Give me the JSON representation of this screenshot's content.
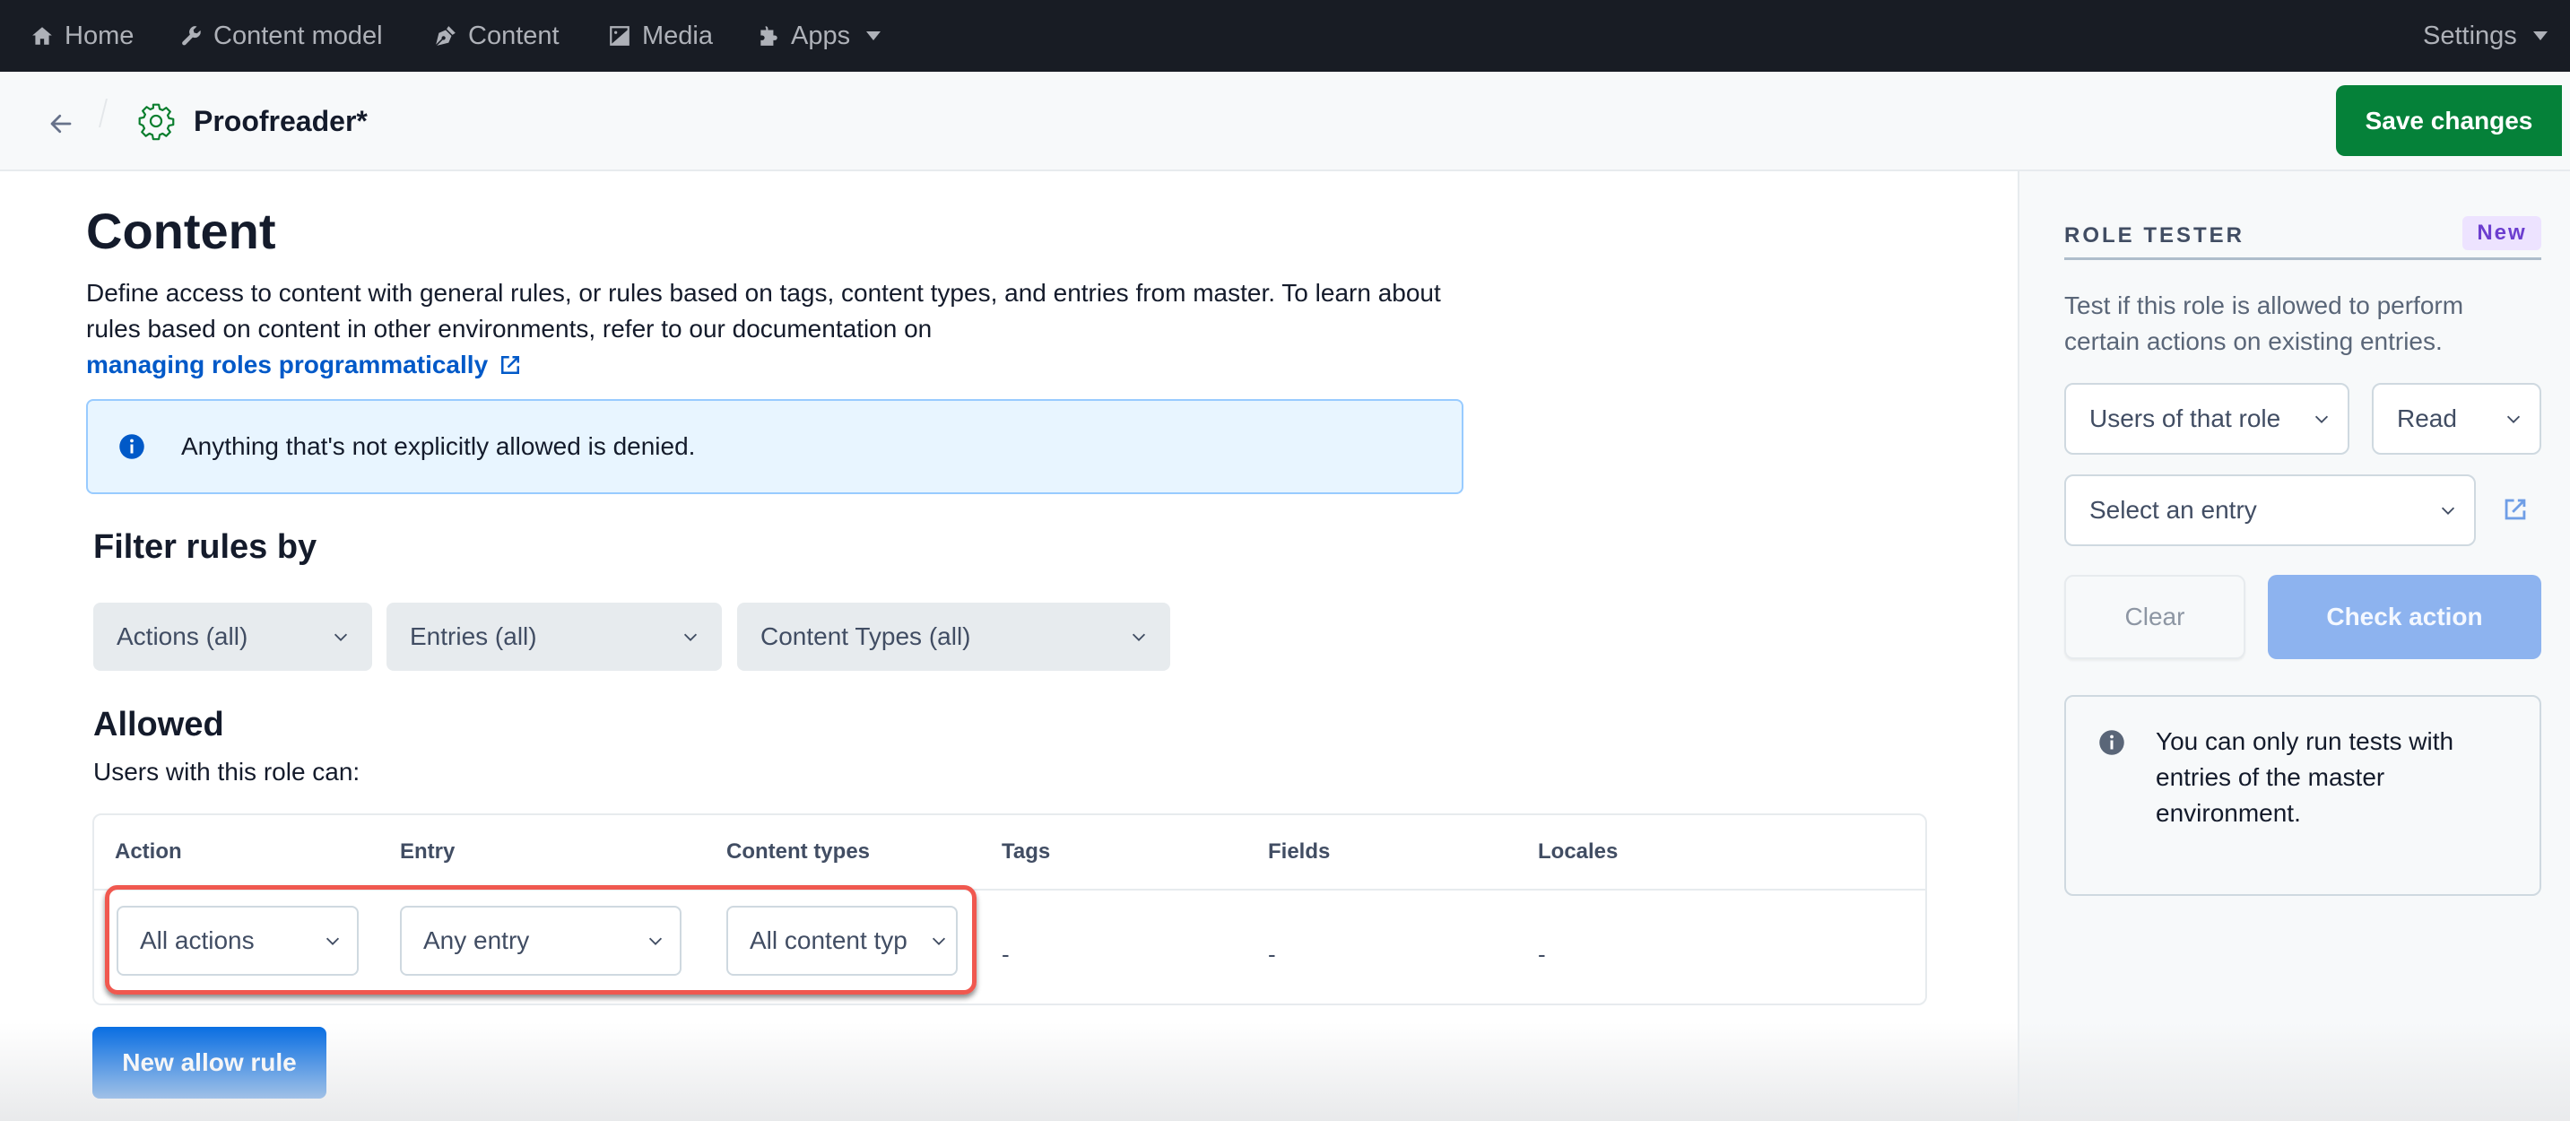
{
  "topnav": {
    "items": [
      {
        "label": "Home",
        "icon": "home-icon"
      },
      {
        "label": "Content model",
        "icon": "wrench-icon"
      },
      {
        "label": "Content",
        "icon": "pen-nib-icon"
      },
      {
        "label": "Media",
        "icon": "image-icon"
      },
      {
        "label": "Apps",
        "icon": "puzzle-icon",
        "has_dropdown": true
      }
    ],
    "settings": {
      "label": "Settings",
      "has_dropdown": true
    }
  },
  "header": {
    "back_icon": "arrow-left-icon",
    "role_icon": "gear-icon",
    "title": "Proofreader*",
    "save_label": "Save changes",
    "save_color": "#058139"
  },
  "main": {
    "title": "Content",
    "description": "Define access to content with general rules, or rules based on tags, content types, and entries from master. To learn about rules based on content in other environments, refer to our documentation on",
    "doc_link": "managing roles programmatically",
    "note": "Anything that's not explicitly allowed is denied.",
    "filter_title": "Filter rules by",
    "filters": [
      {
        "value": "Actions (all)"
      },
      {
        "value": "Entries (all)"
      },
      {
        "value": "Content Types (all)"
      }
    ],
    "allowed_title": "Allowed",
    "allowed_subtitle": "Users with this role can:",
    "table": {
      "columns": [
        "Action",
        "Entry",
        "Content types",
        "Tags",
        "Fields",
        "Locales"
      ],
      "rows": [
        {
          "action": "All actions",
          "entry": "Any entry",
          "content_types": "All content typ",
          "tags": "-",
          "fields": "-",
          "locales": "-"
        }
      ]
    },
    "new_rule_label": "New allow rule",
    "accent_color": "#0069e2"
  },
  "role_tester": {
    "heading": "ROLE TESTER",
    "badge": "New",
    "description": "Test if this role is allowed to perform certain actions on existing entries.",
    "subject_select": "Users of that role",
    "action_select": "Read",
    "entry_select": "Select an entry",
    "clear_label": "Clear",
    "check_label": "Check action",
    "note": "You can only run tests with entries of the master environment."
  }
}
